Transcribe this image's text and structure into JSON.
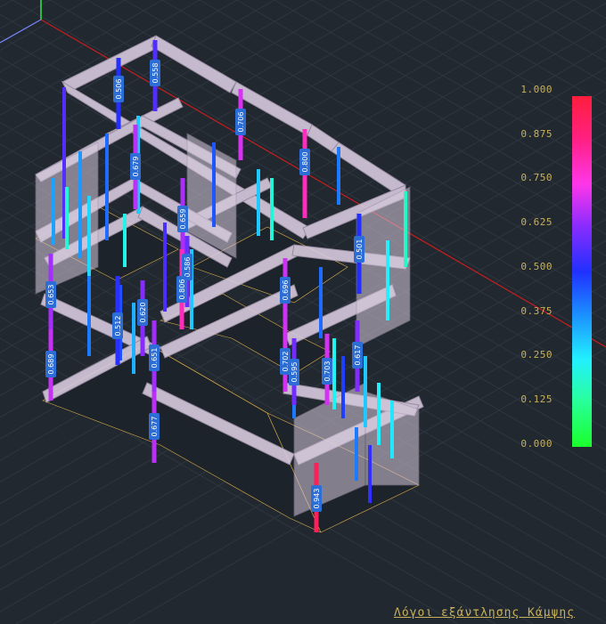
{
  "legend": {
    "scale_labels": [
      "1.000",
      "0.875",
      "0.750",
      "0.625",
      "0.500",
      "0.375",
      "0.250",
      "0.125",
      "0.000"
    ],
    "colors": [
      "#ff1e3c",
      "#ff2080",
      "#ff36e8",
      "#8a2cff",
      "#2030ff",
      "#1b8dff",
      "#22f0ff",
      "#28ff9a",
      "#1aff2a"
    ]
  },
  "caption": "Λόγοι εξάντλησης Κάμψης",
  "column_ratios": [
    "0.506",
    "0.558",
    "0.706",
    "0.679",
    "0.800",
    "0.659",
    "0.501",
    "0.653",
    "0.586",
    "0.806",
    "0.696",
    "0.512",
    "0.620",
    "0.689",
    "0.651",
    "0.702",
    "0.595",
    "0.703",
    "0.617",
    "0.677",
    "0.943"
  ],
  "colors": {
    "background": "#212830",
    "grid": "#2c343c",
    "frame": "#d9cde0",
    "slab_mesh": "#e8b64a",
    "legend_text": "#c9b15a",
    "tag_bg": "#2c6ed6"
  }
}
